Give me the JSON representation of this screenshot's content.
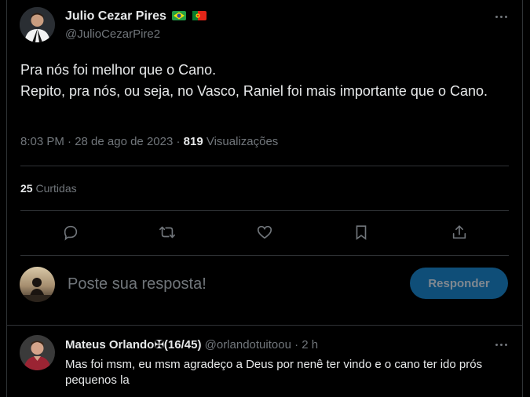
{
  "author": {
    "name": "Julio Cezar Pires",
    "handle": "@JulioCezarPire2",
    "flags": [
      "brazil-flag-icon",
      "portugal-flag-icon"
    ]
  },
  "tweet": {
    "lines": [
      "Pra nós foi melhor que o Cano.",
      "Repito, pra nós, ou seja, no Vasco, Raniel foi mais importante que o Cano."
    ],
    "time": "8:03 PM · 28 de ago de 2023 · ",
    "views_count": "819",
    "views_label": " Visualizações",
    "likes_count": "25",
    "likes_label": " Curtidas"
  },
  "actions": [
    "reply-icon",
    "retweet-icon",
    "like-icon",
    "bookmark-icon",
    "share-icon"
  ],
  "composer": {
    "placeholder": "Poste sua resposta!",
    "button_label": "Responder"
  },
  "reply": {
    "name": "Mateus Orlando✠(16/45)",
    "handle_time": " @orlandotuitoou · 2 h",
    "text": "Mas foi msm, eu msm agradeço a Deus por nenê ter vindo e o cano ter ido prós pequenos la"
  },
  "colors": {
    "background": "#000000",
    "text": "#e7e9ea",
    "muted": "#71767b",
    "border": "#2f3336",
    "button_bg": "#0f4e78"
  }
}
